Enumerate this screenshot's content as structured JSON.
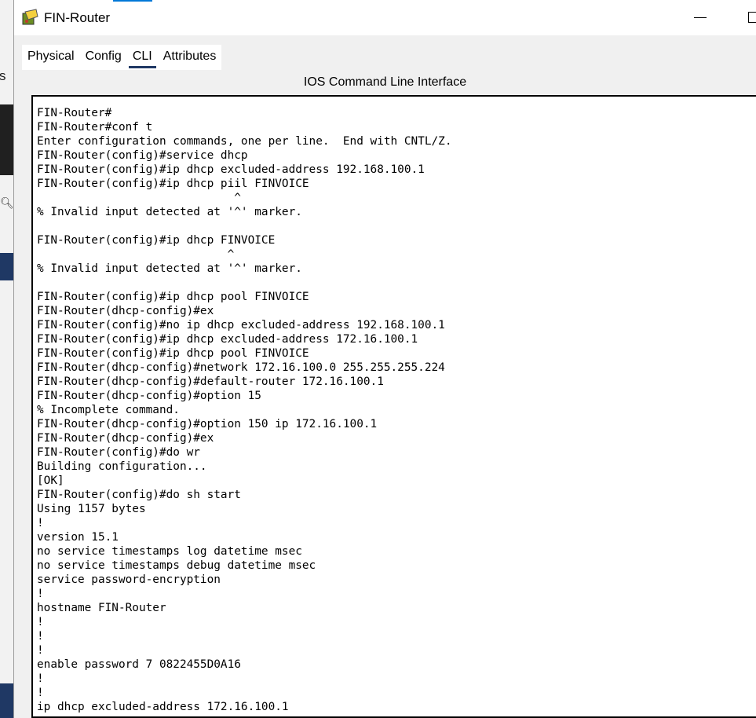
{
  "window": {
    "title": "FIN-Router"
  },
  "tabs": [
    {
      "label": "Physical",
      "active": false
    },
    {
      "label": "Config",
      "active": false
    },
    {
      "label": "CLI",
      "active": true
    },
    {
      "label": "Attributes",
      "active": false
    }
  ],
  "cli": {
    "heading": "IOS Command Line Interface",
    "lines": [
      "FIN-Router#",
      "FIN-Router#conf t",
      "Enter configuration commands, one per line.  End with CNTL/Z.",
      "FIN-Router(config)#service dhcp",
      "FIN-Router(config)#ip dhcp excluded-address 192.168.100.1",
      "FIN-Router(config)#ip dhcp piil FINVOICE",
      "                             ^",
      "% Invalid input detected at '^' marker.",
      "",
      "FIN-Router(config)#ip dhcp FINVOICE",
      "                            ^",
      "% Invalid input detected at '^' marker.",
      "",
      "FIN-Router(config)#ip dhcp pool FINVOICE",
      "FIN-Router(dhcp-config)#ex",
      "FIN-Router(config)#no ip dhcp excluded-address 192.168.100.1",
      "FIN-Router(config)#ip dhcp excluded-address 172.16.100.1",
      "FIN-Router(config)#ip dhcp pool FINVOICE",
      "FIN-Router(dhcp-config)#network 172.16.100.0 255.255.255.224",
      "FIN-Router(dhcp-config)#default-router 172.16.100.1",
      "FIN-Router(dhcp-config)#option 15",
      "% Incomplete command.",
      "FIN-Router(dhcp-config)#option 150 ip 172.16.100.1",
      "FIN-Router(dhcp-config)#ex",
      "FIN-Router(config)#do wr",
      "Building configuration...",
      "[OK]",
      "FIN-Router(config)#do sh start",
      "Using 1157 bytes",
      "!",
      "version 15.1",
      "no service timestamps log datetime msec",
      "no service timestamps debug datetime msec",
      "service password-encryption",
      "!",
      "hostname FIN-Router",
      "!",
      "!",
      "!",
      "enable password 7 0822455D0A16",
      "!",
      "!",
      "ip dhcp excluded-address 172.16.100.1"
    ]
  }
}
